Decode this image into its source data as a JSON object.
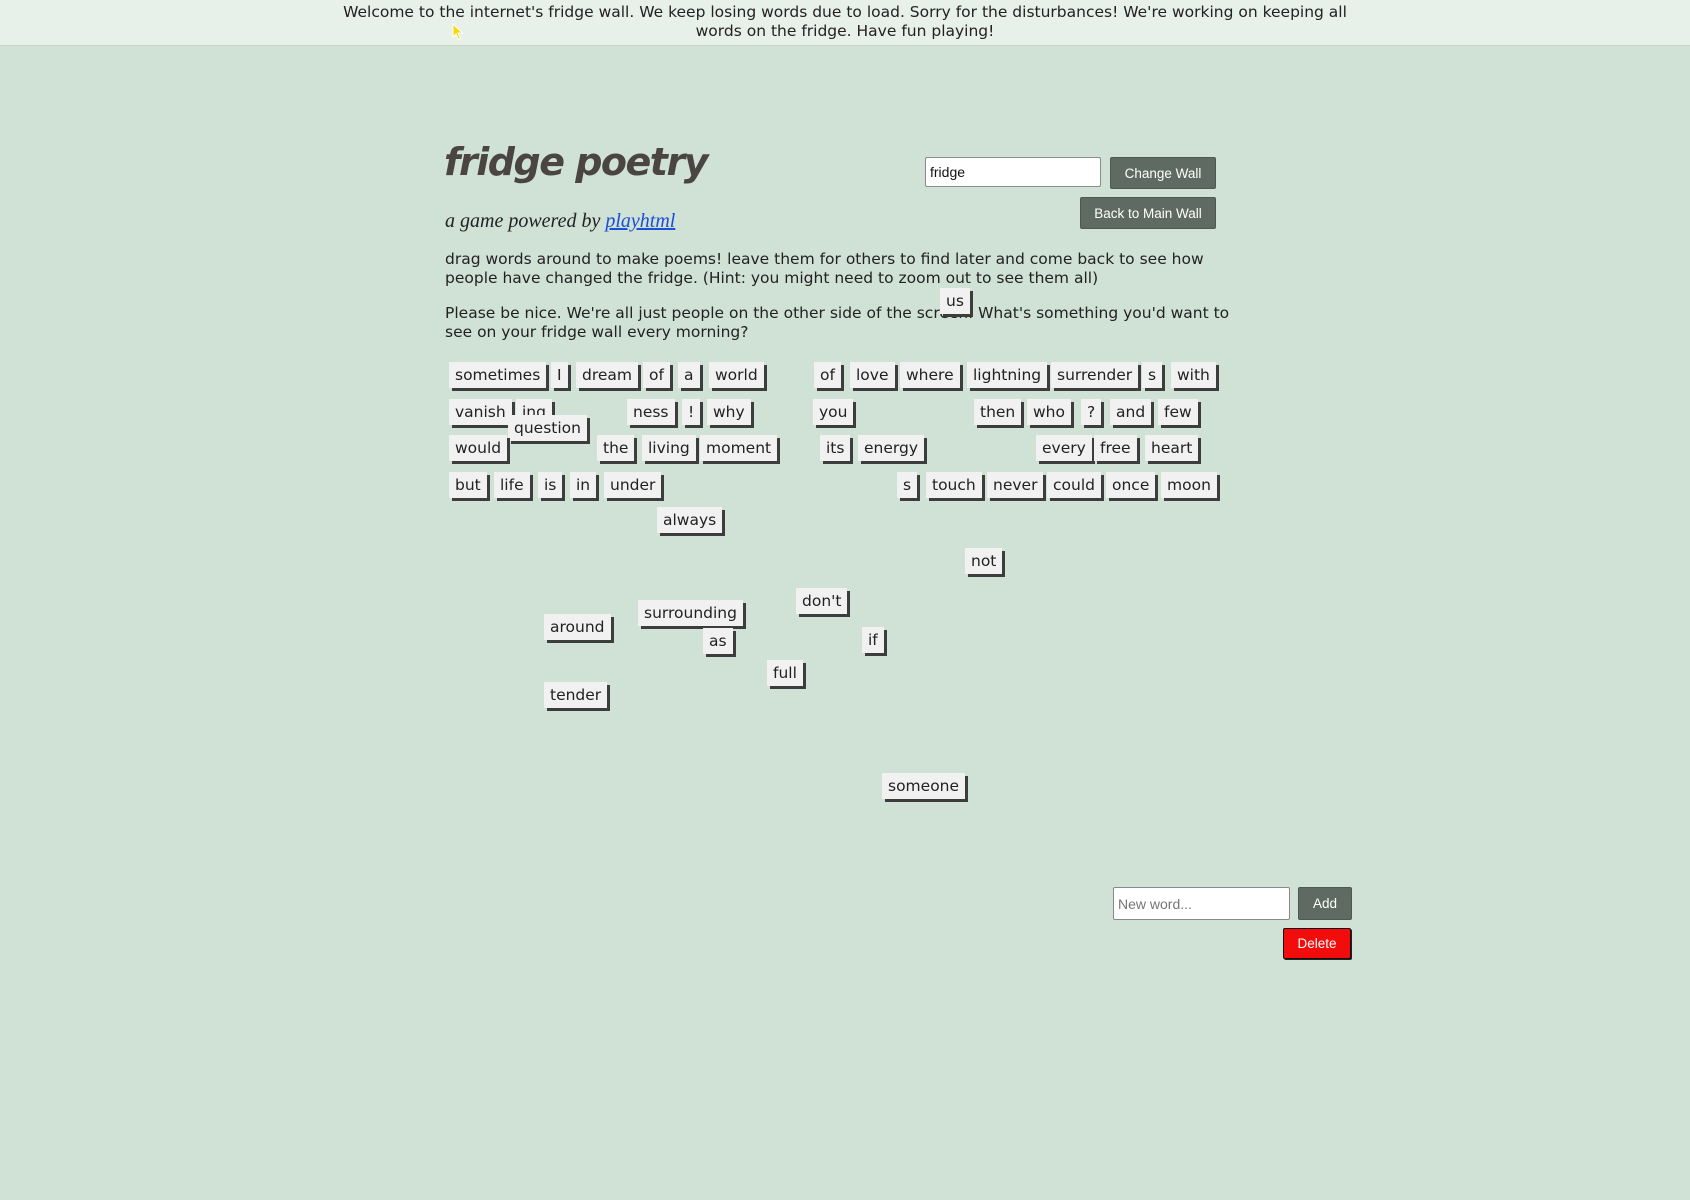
{
  "banner": {
    "text": "Welcome to the internet's fridge wall. We keep losing words due to load. Sorry for the disturbances! We're working on keeping all words on the fridge. Have fun playing!"
  },
  "header": {
    "title": "fridge poetry",
    "subtitle_prefix": "a game powered by ",
    "subtitle_link": "playhtml",
    "wall_input_value": "fridge",
    "change_wall_label": "Change Wall",
    "back_label": "Back to Main Wall"
  },
  "intro": {
    "p1": "drag words around to make poems! leave them for others to find later and come back to see how people have changed the fridge. (Hint: you might need to zoom out to see them all)",
    "p2": "Please be nice. We're all just people on the other side of the screen. What's something you'd want to see on your fridge wall every morning?"
  },
  "words": [
    "sometimes",
    "I",
    "dream",
    "of",
    "a",
    "world",
    "of",
    "love",
    "where",
    "lightning",
    "surrender",
    "s",
    "with",
    "vanish",
    "ing",
    "question",
    "ness",
    "!",
    "why",
    "you",
    "then",
    "who",
    "?",
    "and",
    "few",
    "would",
    "the",
    "living",
    "moment",
    "its",
    "energy",
    "every",
    "free",
    "heart",
    "but",
    "life",
    "is",
    "in",
    "under",
    "s",
    "touch",
    "never",
    "could",
    "once",
    "moon",
    "always",
    "not",
    "don't",
    "surrounding",
    "around",
    "as",
    "if",
    "full",
    "tender",
    "someone",
    "us"
  ],
  "controls": {
    "new_word_placeholder": "New word...",
    "add_label": "Add",
    "delete_label": "Delete"
  },
  "colors": {
    "background": "#d0e1d6",
    "button": "#5f6b62",
    "delete": "#f20c0c",
    "magnet": "#f1f1f1"
  }
}
